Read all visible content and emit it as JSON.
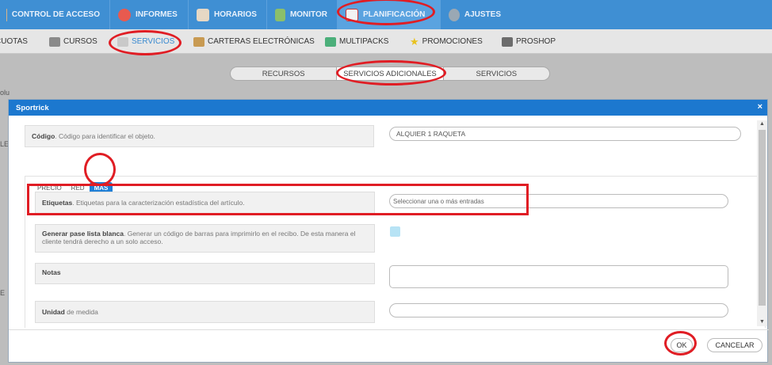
{
  "topnav": {
    "items": [
      {
        "label": "CONTROL DE ACCESO",
        "icon": "access-icon"
      },
      {
        "label": "INFORMES",
        "icon": "pie-chart-icon"
      },
      {
        "label": "HORARIOS",
        "icon": "calendar-icon"
      },
      {
        "label": "MONITOR",
        "icon": "people-icon"
      },
      {
        "label": "PLANIFICACIÓN",
        "icon": "planning-icon"
      },
      {
        "label": "AJUSTES",
        "icon": "gear-icon"
      }
    ]
  },
  "subnav": {
    "items": [
      {
        "label": "CUOTAS"
      },
      {
        "label": "CURSOS",
        "icon": "courses-icon"
      },
      {
        "label": "SERVICIOS",
        "icon": "services-icon"
      },
      {
        "label": "CARTERAS ELECTRÓNICAS",
        "icon": "wallet-icon"
      },
      {
        "label": "MULTIPACKS",
        "icon": "multipack-icon"
      },
      {
        "label": "PROMOCIONES",
        "icon": "star-icon"
      },
      {
        "label": "PROSHOP",
        "icon": "proshop-icon"
      }
    ]
  },
  "segments": [
    "RECURSOS",
    "SERVICIOS ADICIONALES",
    "SERVICIOS"
  ],
  "bg_fragments": [
    "olu",
    "LE",
    "E"
  ],
  "modal": {
    "title": "Sportrick",
    "close": "×",
    "codigo": {
      "label": "Código",
      "desc": ". Código para identificar el objeto.",
      "value": "ALQUIER 1 RAQUETA"
    },
    "tabs": [
      "PRECIO",
      "RED",
      "MÁS"
    ],
    "etiquetas": {
      "label": "Etiquetas",
      "desc": ". Etiquetas para la caracterización estadística del artículo.",
      "placeholder": "Seleccionar una o más entradas"
    },
    "pase": {
      "label": "Generar pase lista blanca",
      "desc": ". Generar un código de barras para imprimirlo en el recibo. De esta manera el cliente tendrá derecho a un solo acceso."
    },
    "notas": {
      "label": "Notas"
    },
    "unidad": {
      "label": "Unidad",
      "desc": " de medida"
    },
    "ok": "OK",
    "cancel": "CANCELAR"
  },
  "colors": {
    "brand": "#3f8fd3",
    "modal_header": "#1c78cf",
    "highlight": "#e01d24"
  }
}
